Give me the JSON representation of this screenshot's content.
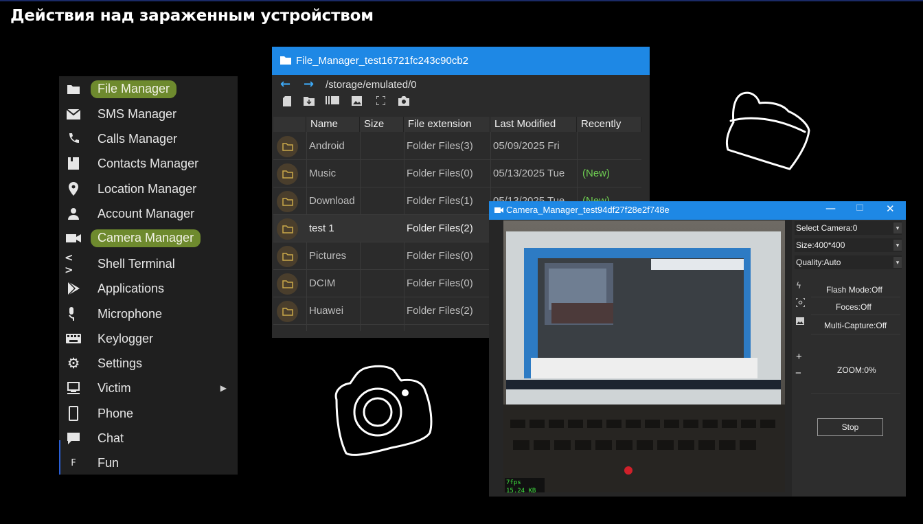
{
  "slide": {
    "title": "Действия над зараженным устройством"
  },
  "menu": {
    "items": [
      {
        "label": "File Manager",
        "icon": "folder-icon",
        "highlighted": true
      },
      {
        "label": "SMS Manager",
        "icon": "mail-icon"
      },
      {
        "label": "Calls Manager",
        "icon": "phone-icon"
      },
      {
        "label": "Contacts Manager",
        "icon": "contacts-icon"
      },
      {
        "label": "Location Manager",
        "icon": "location-pin-icon"
      },
      {
        "label": "Account Manager",
        "icon": "user-icon"
      },
      {
        "label": "Camera Manager",
        "icon": "video-camera-icon",
        "highlighted": true
      },
      {
        "label": "Shell Terminal",
        "icon": "code-icon"
      },
      {
        "label": "Applications",
        "icon": "play-store-icon"
      },
      {
        "label": "Microphone",
        "icon": "microphone-icon"
      },
      {
        "label": "Keylogger",
        "icon": "keyboard-icon"
      },
      {
        "label": "Settings",
        "icon": "gear-icon"
      },
      {
        "label": "Victim",
        "icon": "computer-icon",
        "submenu": true
      },
      {
        "label": "Phone",
        "icon": "smartphone-icon"
      },
      {
        "label": "Chat",
        "icon": "chat-icon"
      },
      {
        "label": "Fun",
        "icon": "fun-icon"
      }
    ],
    "highlight_color": "#6e8a2e"
  },
  "file_manager": {
    "title": "File_Manager_test16721fc243c90cb2",
    "path": "/storage/emulated/0",
    "accent": "#1e88e5",
    "columns": [
      "Name",
      "Size",
      "File extension",
      "Last Modified",
      "Recently"
    ],
    "rows": [
      {
        "name": "Android",
        "size": "",
        "ext": "Folder Files(3)",
        "modified": "05/09/2025 Fri",
        "recent": ""
      },
      {
        "name": "Music",
        "size": "",
        "ext": "Folder Files(0)",
        "modified": "05/13/2025 Tue",
        "recent": "(New)"
      },
      {
        "name": "Download",
        "size": "",
        "ext": "Folder Files(1)",
        "modified": "05/13/2025 Tue",
        "recent": "(New)"
      },
      {
        "name": "test 1",
        "size": "",
        "ext": "Folder Files(2)",
        "modified": "",
        "recent": ""
      },
      {
        "name": "Pictures",
        "size": "",
        "ext": "Folder Files(0)",
        "modified": "",
        "recent": ""
      },
      {
        "name": "DCIM",
        "size": "",
        "ext": "Folder Files(0)",
        "modified": "",
        "recent": ""
      },
      {
        "name": "Huawei",
        "size": "",
        "ext": "Folder Files(2)",
        "modified": "",
        "recent": ""
      }
    ],
    "new_color": "#6fcf52"
  },
  "camera_manager": {
    "title": "Camera_Manager_test94df27f28e2f748e",
    "select_camera": "Select Camera:0",
    "size": "Size:400*400",
    "quality": "Quality:Auto",
    "flash_mode": "Flash Mode:Off",
    "foces": "Foces:Off",
    "multi_capture": "Multi-Capture:Off",
    "zoom_in": "+",
    "zoom_out": "−",
    "zoom": "ZOOM:0%",
    "stop_label": "Stop",
    "fps": "7fps",
    "kb": "15.24 KB"
  }
}
